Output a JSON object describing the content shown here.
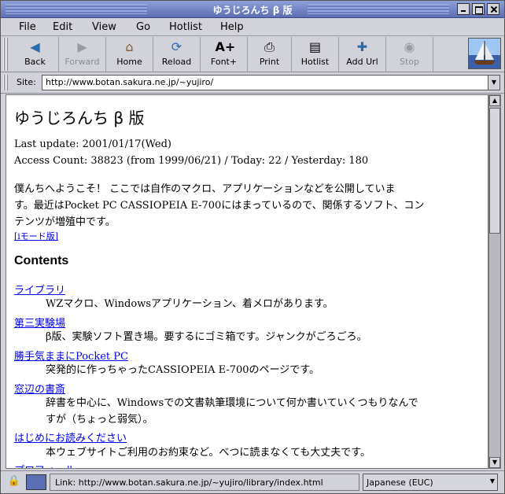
{
  "window": {
    "title": "ゆうじろんち β 版"
  },
  "menu": [
    "File",
    "Edit",
    "View",
    "Go",
    "Hotlist",
    "Help"
  ],
  "toolbar": {
    "back": "Back",
    "forward": "Forward",
    "home": "Home",
    "reload": "Reload",
    "fontplus": "Font+",
    "print": "Print",
    "hotlist": "Hotlist",
    "addurl": "Add Url",
    "stop": "Stop"
  },
  "location": {
    "label": "Site:",
    "url": "http://www.botan.sakura.ne.jp/~yujiro/"
  },
  "page": {
    "heading": "ゆうじろんち β 版",
    "last_update": "Last update: 2001/01/17(Wed)",
    "access": "Access Count: 38823 (from 1999/06/21) / Today: 22 / Yesterday: 180",
    "intro1": "僕んちへようこそ！ ここでは自作のマクロ、アプリケーションなどを公開していま",
    "intro2": "す。最近はPocket PC CASSIOPEIA E-700にはまっているので、関係するソフト、コン",
    "intro3": "テンツが増殖中です。",
    "imode": "[iモード版]",
    "contents": "Contents",
    "items": [
      {
        "title": "ライブラリ",
        "desc": "WZマクロ、Windowsアプリケーション、着メロがあります。"
      },
      {
        "title": "第三実験場",
        "desc": "β版、実験ソフト置き場。要するにゴミ箱です。ジャンクがごろごろ。"
      },
      {
        "title": "勝手気ままにPocket PC",
        "desc": "突発的に作っちゃったCASSIOPEIA E-700のページです。"
      },
      {
        "title": "窓辺の書斎",
        "desc1": "辞書を中心に、Windowsでの文書執筆環境について何か書いていくつもりなんで",
        "desc2": "すが（ちょっと弱気）。"
      },
      {
        "title": "はじめにお読みください",
        "desc": "本ウェブサイトご利用のお約束など。べつに読まなくても大丈夫です。"
      },
      {
        "title": "プロフィール"
      }
    ]
  },
  "status": {
    "link": "Link: http://www.botan.sakura.ne.jp/~yujiro/library/index.html",
    "encoding": "Japanese (EUC)"
  }
}
